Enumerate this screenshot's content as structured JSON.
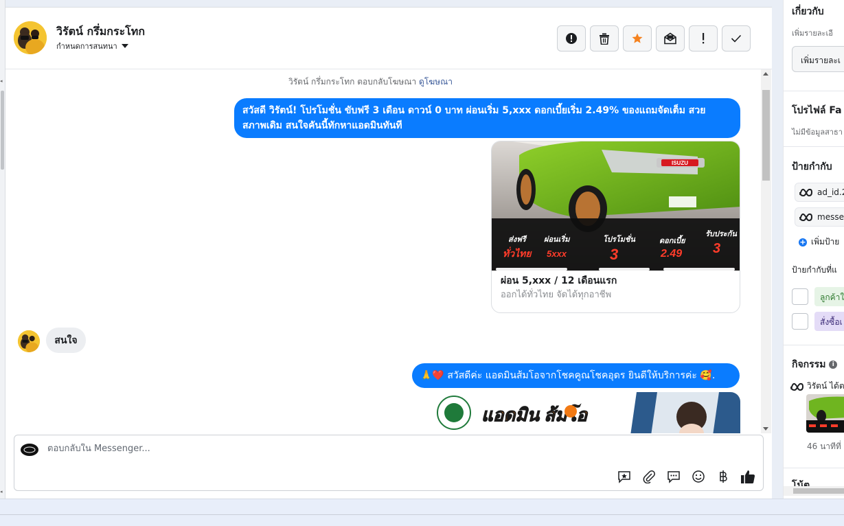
{
  "contact": {
    "name": "วิรัตน์ กรึ่มกระโทก",
    "assign_label": "กำหนดการสนทนา"
  },
  "header_actions": [
    {
      "name": "report-icon"
    },
    {
      "name": "trash-icon"
    },
    {
      "name": "star-icon",
      "color": "#f5821f"
    },
    {
      "name": "mark-unread-icon"
    },
    {
      "name": "exclamation-icon"
    },
    {
      "name": "check-icon"
    }
  ],
  "messages": {
    "reply_note_text": "วิรัตน์ กรึ่มกระโทก ตอบกลับโฆษณา",
    "reply_note_link": "ดูโฆษณา",
    "outgoing_1": "สวัสดี วิรัตน์! โปรโมชั่น ขับฟรี 3 เดือน ดาวน์ 0 บาท ผ่อนเริ่ม 5,xxx  ดอกเบี้ยเริ่ม 2.49% ของแถมจัดเต็ม สวย สภาพเดิม สนใจคันนี้ทักหาแอดมินทันที",
    "card": {
      "title": "ผ่อน 5,xxx / 12 เดือนแรก",
      "subtitle": "ออกได้ทั่วไทย จัดได้ทุกอาชีพ",
      "banner": {
        "items": [
          {
            "top": "ส่งฟรี",
            "bottom": "ทั่วไทย"
          },
          {
            "top": "ผ่อนเริ่ม",
            "bottom": "5xxx"
          },
          {
            "top": "โปรโมชั่น",
            "bottom": "3"
          },
          {
            "top": "ดอกเบี้ย",
            "bottom": "2.49"
          },
          {
            "top": "รับประกัน",
            "bottom": "3"
          }
        ],
        "brand": "ISUZU"
      }
    },
    "incoming_1": "สนใจ",
    "outgoing_2": "🙏❤️ สวัสดีค่ะ แอดมินส้มโอจากโชคคูณโชคอุดร ยินดีให้บริการค่ะ 🥰.",
    "card2_banner_text": "แอดมิน ส้มโอ"
  },
  "composer": {
    "placeholder": "ตอบกลับใน Messenger...",
    "tools": [
      "saved-reply-icon",
      "attach-icon",
      "chat-bubble-icon",
      "emoji-icon",
      "baht-icon",
      "like-icon"
    ]
  },
  "right_panel": {
    "about": {
      "title": "เกี่ยวกับ",
      "subtitle": "เพิ่มรายละเอี",
      "button": "เพิ่มรายละเ"
    },
    "fb_profile": {
      "title": "โปรไฟล์ Fa",
      "subtitle": "ไม่มีข้อมูลสาธา"
    },
    "tags": {
      "title": "ป้ายกำกับ",
      "items": [
        "ad_id.2",
        "messe"
      ],
      "add_label": "เพิ่มป้าย"
    },
    "suggested": {
      "title": "ป้ายกำกับที่แ",
      "items": [
        {
          "label": "ลูกค้าใ",
          "color": "#e6f4e6"
        },
        {
          "label": "สั่งซื้อเ",
          "color": "#e4dcf7"
        }
      ]
    },
    "activity": {
      "title": "กิจกรรม",
      "line": "วิรัตน์ ได้ต",
      "time": "46 นาทีที่"
    },
    "notes": {
      "title": "โน้ต"
    }
  }
}
